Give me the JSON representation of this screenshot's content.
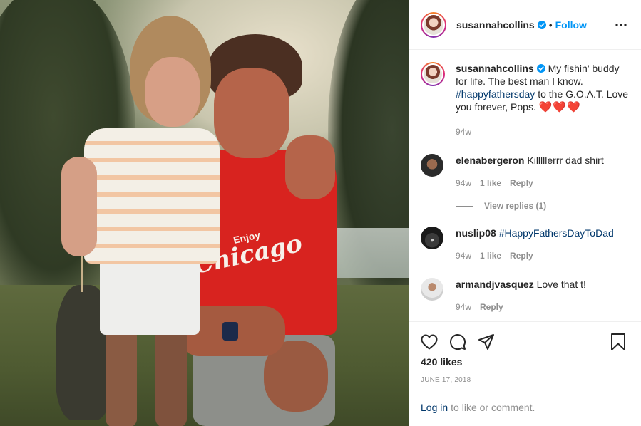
{
  "header": {
    "username": "susannahcollins",
    "separator": "•",
    "follow_label": "Follow"
  },
  "caption": {
    "username": "susannahcollins",
    "text_before": "My fishin' buddy for life. The best man I know.",
    "hashtag": "#happyfathersday",
    "text_after": "to the G.O.A.T. Love you forever, Pops.",
    "hearts": "❤️❤️❤️",
    "time": "94w"
  },
  "comments": [
    {
      "username": "elenabergeron",
      "text": "Killlllerrr dad shirt",
      "time": "94w",
      "likes": "1 like",
      "reply": "Reply",
      "view_replies": "View replies (1)"
    },
    {
      "username": "nuslip08",
      "hashtag": "#HappyFathersDayToDad",
      "time": "94w",
      "likes": "1 like",
      "reply": "Reply"
    },
    {
      "username": "armandjvasquez",
      "text": "Love that t!",
      "time": "94w",
      "reply": "Reply"
    }
  ],
  "likes_count": "420 likes",
  "date": "JUNE 17, 2018",
  "login_bar": {
    "link": "Log in",
    "text": "to like or comment."
  },
  "photo": {
    "shirt_text_top": "Enjoy",
    "shirt_text_main": "Chicago"
  },
  "colors": {
    "accent": "#0095f6",
    "hashtag": "#00376b",
    "muted": "#8e8e8e",
    "text": "#262626"
  },
  "icons": [
    "verified-badge-icon",
    "more-options-icon",
    "heart-icon",
    "comment-icon",
    "share-icon",
    "bookmark-icon"
  ]
}
